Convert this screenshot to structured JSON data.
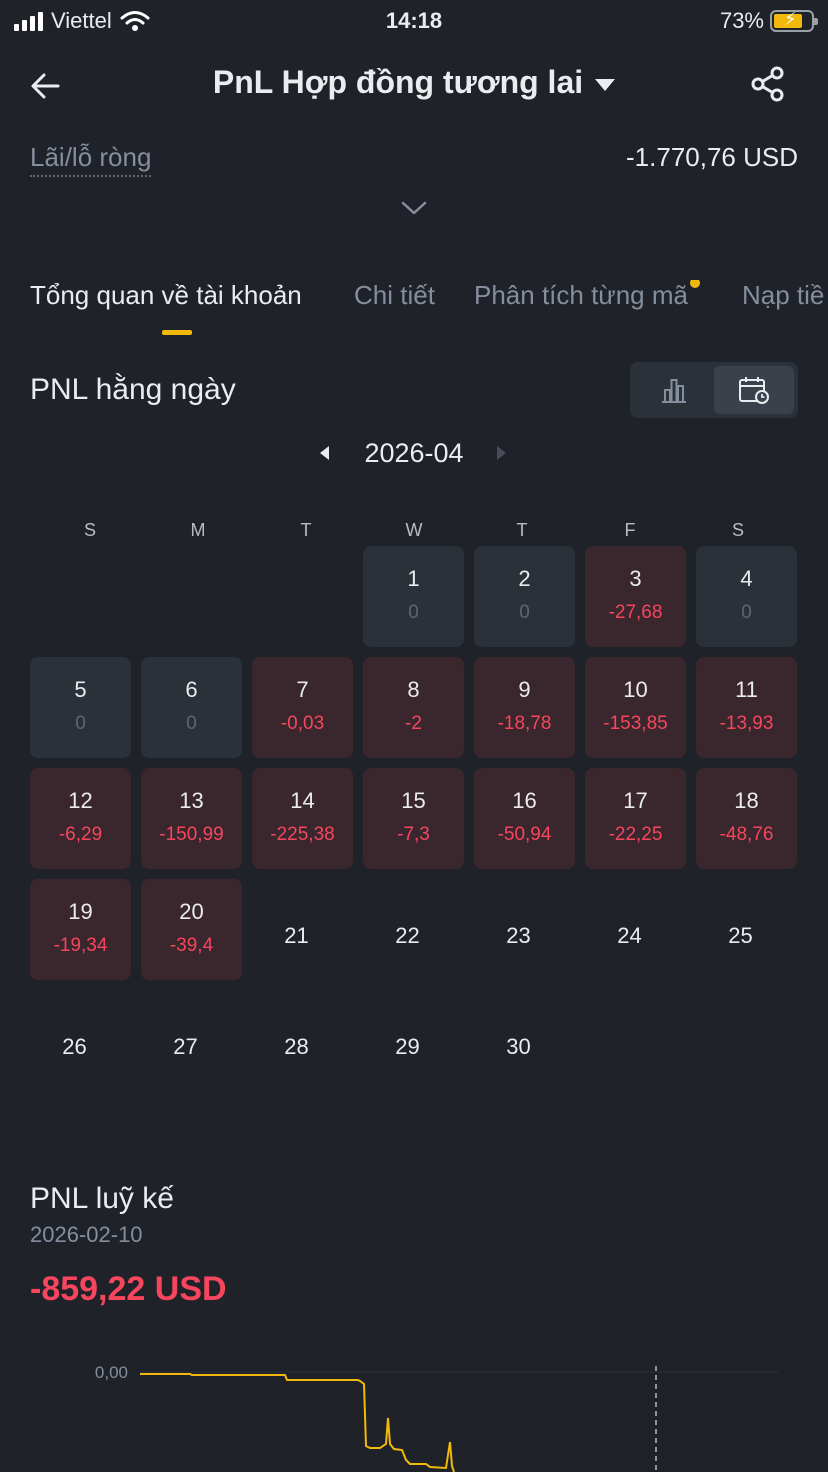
{
  "status": {
    "carrier": "Viettel",
    "time": "14:18",
    "battery": "73%"
  },
  "header": {
    "title": "PnL Hợp đồng tương lai"
  },
  "summary": {
    "net_label": "Lãi/lỗ ròng",
    "net_value": "-1.770,76 USD"
  },
  "tabs": [
    {
      "label": "Tổng quan về tài khoản"
    },
    {
      "label": "Chi tiết"
    },
    {
      "label": "Phân tích từng mã"
    },
    {
      "label": "Nạp tiề"
    }
  ],
  "daily": {
    "title": "PNL hằng ngày",
    "month": "2026-04",
    "weekdays": [
      "S",
      "M",
      "T",
      "W",
      "T",
      "F",
      "S"
    ],
    "days": [
      {
        "d": "1",
        "v": "0"
      },
      {
        "d": "2",
        "v": "0"
      },
      {
        "d": "3",
        "v": "-27,68"
      },
      {
        "d": "4",
        "v": "0"
      },
      {
        "d": "5",
        "v": "0"
      },
      {
        "d": "6",
        "v": "0"
      },
      {
        "d": "7",
        "v": "-0,03"
      },
      {
        "d": "8",
        "v": "-2"
      },
      {
        "d": "9",
        "v": "-18,78"
      },
      {
        "d": "10",
        "v": "-153,85"
      },
      {
        "d": "11",
        "v": "-13,93"
      },
      {
        "d": "12",
        "v": "-6,29"
      },
      {
        "d": "13",
        "v": "-150,99"
      },
      {
        "d": "14",
        "v": "-225,38"
      },
      {
        "d": "15",
        "v": "-7,3"
      },
      {
        "d": "16",
        "v": "-50,94"
      },
      {
        "d": "17",
        "v": "-22,25"
      },
      {
        "d": "18",
        "v": "-48,76"
      },
      {
        "d": "19",
        "v": "-19,34"
      },
      {
        "d": "20",
        "v": "-39,4"
      },
      {
        "d": "21"
      },
      {
        "d": "22"
      },
      {
        "d": "23"
      },
      {
        "d": "24"
      },
      {
        "d": "25"
      },
      {
        "d": "26"
      },
      {
        "d": "27"
      },
      {
        "d": "28"
      },
      {
        "d": "29"
      },
      {
        "d": "30"
      }
    ]
  },
  "cumulative": {
    "title": "PNL luỹ kế",
    "date": "2026-02-10",
    "value": "-859,22 USD",
    "axis_label": "0,00"
  },
  "colors": {
    "accent": "#f0b90b",
    "loss": "#f6465d",
    "bg": "#1f2329",
    "cell": "#2b3139",
    "loss_cell": "#3a262d"
  }
}
